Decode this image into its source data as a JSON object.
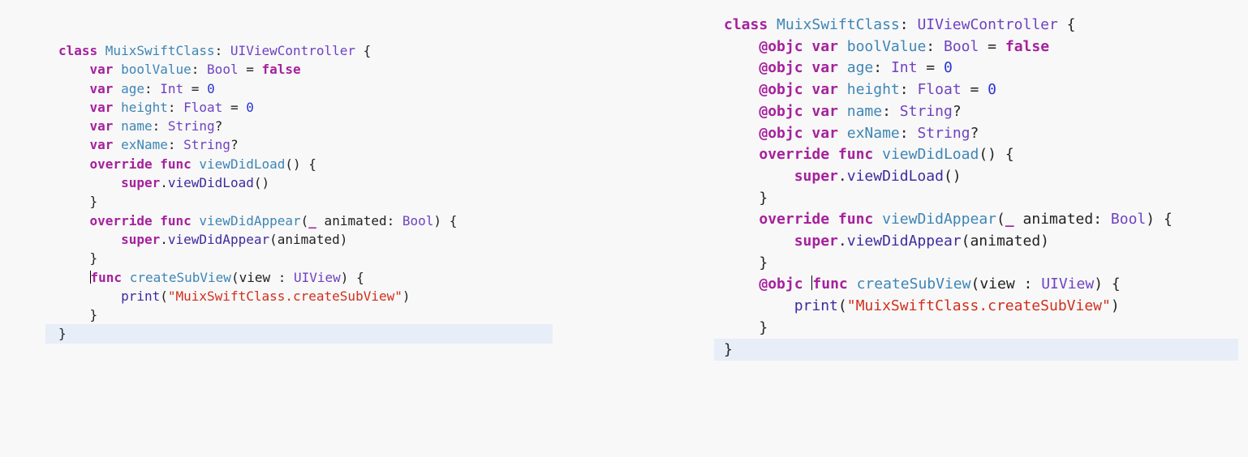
{
  "left_editor": {
    "code_lines": [
      [
        {
          "text": "class ",
          "kind": "kw"
        },
        {
          "text": "MuixSwiftClass",
          "kind": "name"
        },
        {
          "text": ": ",
          "kind": "plain"
        },
        {
          "text": "UIViewController",
          "kind": "type"
        },
        {
          "text": " {",
          "kind": "plain"
        }
      ],
      [
        {
          "text": "    ",
          "kind": "plain"
        },
        {
          "text": "var",
          "kind": "kw"
        },
        {
          "text": " ",
          "kind": "plain"
        },
        {
          "text": "boolValue",
          "kind": "name"
        },
        {
          "text": ": ",
          "kind": "plain"
        },
        {
          "text": "Bool",
          "kind": "type"
        },
        {
          "text": " = ",
          "kind": "plain"
        },
        {
          "text": "false",
          "kind": "kw"
        }
      ],
      [
        {
          "text": "    ",
          "kind": "plain"
        },
        {
          "text": "var",
          "kind": "kw"
        },
        {
          "text": " ",
          "kind": "plain"
        },
        {
          "text": "age",
          "kind": "name"
        },
        {
          "text": ": ",
          "kind": "plain"
        },
        {
          "text": "Int",
          "kind": "type"
        },
        {
          "text": " = ",
          "kind": "plain"
        },
        {
          "text": "0",
          "kind": "number"
        }
      ],
      [
        {
          "text": "    ",
          "kind": "plain"
        },
        {
          "text": "var",
          "kind": "kw"
        },
        {
          "text": " ",
          "kind": "plain"
        },
        {
          "text": "height",
          "kind": "name"
        },
        {
          "text": ": ",
          "kind": "plain"
        },
        {
          "text": "Float",
          "kind": "type"
        },
        {
          "text": " = ",
          "kind": "plain"
        },
        {
          "text": "0",
          "kind": "number"
        }
      ],
      [
        {
          "text": "    ",
          "kind": "plain"
        },
        {
          "text": "var",
          "kind": "kw"
        },
        {
          "text": " ",
          "kind": "plain"
        },
        {
          "text": "name",
          "kind": "name"
        },
        {
          "text": ": ",
          "kind": "plain"
        },
        {
          "text": "String",
          "kind": "type"
        },
        {
          "text": "?",
          "kind": "plain"
        }
      ],
      [
        {
          "text": "    ",
          "kind": "plain"
        },
        {
          "text": "var",
          "kind": "kw"
        },
        {
          "text": " ",
          "kind": "plain"
        },
        {
          "text": "exName",
          "kind": "name"
        },
        {
          "text": ": ",
          "kind": "plain"
        },
        {
          "text": "String",
          "kind": "type"
        },
        {
          "text": "?",
          "kind": "plain"
        }
      ],
      [
        {
          "text": "",
          "kind": "plain"
        }
      ],
      [
        {
          "text": "    ",
          "kind": "plain"
        },
        {
          "text": "override",
          "kind": "kw"
        },
        {
          "text": " ",
          "kind": "plain"
        },
        {
          "text": "func",
          "kind": "kw"
        },
        {
          "text": " ",
          "kind": "plain"
        },
        {
          "text": "viewDidLoad",
          "kind": "name"
        },
        {
          "text": "() {",
          "kind": "plain"
        }
      ],
      [
        {
          "text": "        ",
          "kind": "plain"
        },
        {
          "text": "super",
          "kind": "kw"
        },
        {
          "text": ".",
          "kind": "plain"
        },
        {
          "text": "viewDidLoad",
          "kind": "builtin"
        },
        {
          "text": "()",
          "kind": "plain"
        }
      ],
      [
        {
          "text": "    }",
          "kind": "plain"
        }
      ],
      [
        {
          "text": "",
          "kind": "plain"
        }
      ],
      [
        {
          "text": "    ",
          "kind": "plain"
        },
        {
          "text": "override",
          "kind": "kw"
        },
        {
          "text": " ",
          "kind": "plain"
        },
        {
          "text": "func",
          "kind": "kw"
        },
        {
          "text": " ",
          "kind": "plain"
        },
        {
          "text": "viewDidAppear",
          "kind": "name"
        },
        {
          "text": "(",
          "kind": "plain"
        },
        {
          "text": "_",
          "kind": "kw"
        },
        {
          "text": " animated: ",
          "kind": "plain"
        },
        {
          "text": "Bool",
          "kind": "type"
        },
        {
          "text": ") {",
          "kind": "plain"
        }
      ],
      [
        {
          "text": "        ",
          "kind": "plain"
        },
        {
          "text": "super",
          "kind": "kw"
        },
        {
          "text": ".",
          "kind": "plain"
        },
        {
          "text": "viewDidAppear",
          "kind": "builtin"
        },
        {
          "text": "(animated)",
          "kind": "plain"
        }
      ],
      [
        {
          "text": "    }",
          "kind": "plain"
        }
      ],
      [
        {
          "text": "",
          "kind": "plain"
        }
      ],
      [
        {
          "text": "    ",
          "kind": "plain"
        },
        {
          "text": "func",
          "kind": "kw"
        },
        {
          "text": " ",
          "kind": "plain"
        },
        {
          "text": "createSubView",
          "kind": "name"
        },
        {
          "text": "(view : ",
          "kind": "plain"
        },
        {
          "text": "UIView",
          "kind": "type"
        },
        {
          "text": ") {",
          "kind": "plain"
        }
      ],
      [
        {
          "text": "        ",
          "kind": "plain"
        },
        {
          "text": "print",
          "kind": "builtin"
        },
        {
          "text": "(",
          "kind": "plain"
        },
        {
          "text": "\"MuixSwiftClass.createSubView\"",
          "kind": "string"
        },
        {
          "text": ")",
          "kind": "plain"
        }
      ],
      [
        {
          "text": "    }",
          "kind": "plain"
        }
      ],
      [
        {
          "text": "}",
          "kind": "plain"
        }
      ]
    ]
  },
  "right_editor": {
    "code_lines": [
      [
        {
          "text": "class ",
          "kind": "kw"
        },
        {
          "text": "MuixSwiftClass",
          "kind": "name"
        },
        {
          "text": ": ",
          "kind": "plain"
        },
        {
          "text": "UIViewController",
          "kind": "type"
        },
        {
          "text": " {",
          "kind": "plain"
        }
      ],
      [
        {
          "text": "    ",
          "kind": "plain"
        },
        {
          "text": "@objc",
          "kind": "kw"
        },
        {
          "text": " ",
          "kind": "plain"
        },
        {
          "text": "var",
          "kind": "kw"
        },
        {
          "text": " ",
          "kind": "plain"
        },
        {
          "text": "boolValue",
          "kind": "name"
        },
        {
          "text": ": ",
          "kind": "plain"
        },
        {
          "text": "Bool",
          "kind": "type"
        },
        {
          "text": " = ",
          "kind": "plain"
        },
        {
          "text": "false",
          "kind": "kw"
        }
      ],
      [
        {
          "text": "    ",
          "kind": "plain"
        },
        {
          "text": "@objc",
          "kind": "kw"
        },
        {
          "text": " ",
          "kind": "plain"
        },
        {
          "text": "var",
          "kind": "kw"
        },
        {
          "text": " ",
          "kind": "plain"
        },
        {
          "text": "age",
          "kind": "name"
        },
        {
          "text": ": ",
          "kind": "plain"
        },
        {
          "text": "Int",
          "kind": "type"
        },
        {
          "text": " = ",
          "kind": "plain"
        },
        {
          "text": "0",
          "kind": "number"
        }
      ],
      [
        {
          "text": "    ",
          "kind": "plain"
        },
        {
          "text": "@objc",
          "kind": "kw"
        },
        {
          "text": " ",
          "kind": "plain"
        },
        {
          "text": "var",
          "kind": "kw"
        },
        {
          "text": " ",
          "kind": "plain"
        },
        {
          "text": "height",
          "kind": "name"
        },
        {
          "text": ": ",
          "kind": "plain"
        },
        {
          "text": "Float",
          "kind": "type"
        },
        {
          "text": " = ",
          "kind": "plain"
        },
        {
          "text": "0",
          "kind": "number"
        }
      ],
      [
        {
          "text": "    ",
          "kind": "plain"
        },
        {
          "text": "@objc",
          "kind": "kw"
        },
        {
          "text": " ",
          "kind": "plain"
        },
        {
          "text": "var",
          "kind": "kw"
        },
        {
          "text": " ",
          "kind": "plain"
        },
        {
          "text": "name",
          "kind": "name"
        },
        {
          "text": ": ",
          "kind": "plain"
        },
        {
          "text": "String",
          "kind": "type"
        },
        {
          "text": "?",
          "kind": "plain"
        }
      ],
      [
        {
          "text": "    ",
          "kind": "plain"
        },
        {
          "text": "@objc",
          "kind": "kw"
        },
        {
          "text": " ",
          "kind": "plain"
        },
        {
          "text": "var",
          "kind": "kw"
        },
        {
          "text": " ",
          "kind": "plain"
        },
        {
          "text": "exName",
          "kind": "name"
        },
        {
          "text": ": ",
          "kind": "plain"
        },
        {
          "text": "String",
          "kind": "type"
        },
        {
          "text": "?",
          "kind": "plain"
        }
      ],
      [
        {
          "text": "",
          "kind": "plain"
        }
      ],
      [
        {
          "text": "    ",
          "kind": "plain"
        },
        {
          "text": "override",
          "kind": "kw"
        },
        {
          "text": " ",
          "kind": "plain"
        },
        {
          "text": "func",
          "kind": "kw"
        },
        {
          "text": " ",
          "kind": "plain"
        },
        {
          "text": "viewDidLoad",
          "kind": "name"
        },
        {
          "text": "() {",
          "kind": "plain"
        }
      ],
      [
        {
          "text": "        ",
          "kind": "plain"
        },
        {
          "text": "super",
          "kind": "kw"
        },
        {
          "text": ".",
          "kind": "plain"
        },
        {
          "text": "viewDidLoad",
          "kind": "builtin"
        },
        {
          "text": "()",
          "kind": "plain"
        }
      ],
      [
        {
          "text": "    }",
          "kind": "plain"
        }
      ],
      [
        {
          "text": "",
          "kind": "plain"
        }
      ],
      [
        {
          "text": "    ",
          "kind": "plain"
        },
        {
          "text": "override",
          "kind": "kw"
        },
        {
          "text": " ",
          "kind": "plain"
        },
        {
          "text": "func",
          "kind": "kw"
        },
        {
          "text": " ",
          "kind": "plain"
        },
        {
          "text": "viewDidAppear",
          "kind": "name"
        },
        {
          "text": "(",
          "kind": "plain"
        },
        {
          "text": "_",
          "kind": "kw"
        },
        {
          "text": " animated: ",
          "kind": "plain"
        },
        {
          "text": "Bool",
          "kind": "type"
        },
        {
          "text": ") {",
          "kind": "plain"
        }
      ],
      [
        {
          "text": "        ",
          "kind": "plain"
        },
        {
          "text": "super",
          "kind": "kw"
        },
        {
          "text": ".",
          "kind": "plain"
        },
        {
          "text": "viewDidAppear",
          "kind": "builtin"
        },
        {
          "text": "(animated)",
          "kind": "plain"
        }
      ],
      [
        {
          "text": "    }",
          "kind": "plain"
        }
      ],
      [
        {
          "text": "",
          "kind": "plain"
        }
      ],
      [
        {
          "text": "    ",
          "kind": "plain"
        },
        {
          "text": "@objc",
          "kind": "kw"
        },
        {
          "text": " ",
          "kind": "plain"
        },
        {
          "text": "func",
          "kind": "kw"
        },
        {
          "text": " ",
          "kind": "plain"
        },
        {
          "text": "createSubView",
          "kind": "name"
        },
        {
          "text": "(view : ",
          "kind": "plain"
        },
        {
          "text": "UIView",
          "kind": "type"
        },
        {
          "text": ") {",
          "kind": "plain"
        }
      ],
      [
        {
          "text": "        ",
          "kind": "plain"
        },
        {
          "text": "print",
          "kind": "builtin"
        },
        {
          "text": "(",
          "kind": "plain"
        },
        {
          "text": "\"MuixSwiftClass.createSubView\"",
          "kind": "string"
        },
        {
          "text": ")",
          "kind": "plain"
        }
      ],
      [
        {
          "text": "    }",
          "kind": "plain"
        }
      ],
      [
        {
          "text": "}",
          "kind": "plain"
        }
      ]
    ]
  },
  "colors": {
    "background": "#f8f8f8",
    "current_line_highlight": "#e7eef8",
    "keyword": "#a5219c",
    "type": "#6f42c1",
    "declaration_name": "#3e85b5",
    "number": "#2933d1",
    "string": "#d12f1b",
    "builtin": "#3f2a9f",
    "plain": "#222222"
  }
}
